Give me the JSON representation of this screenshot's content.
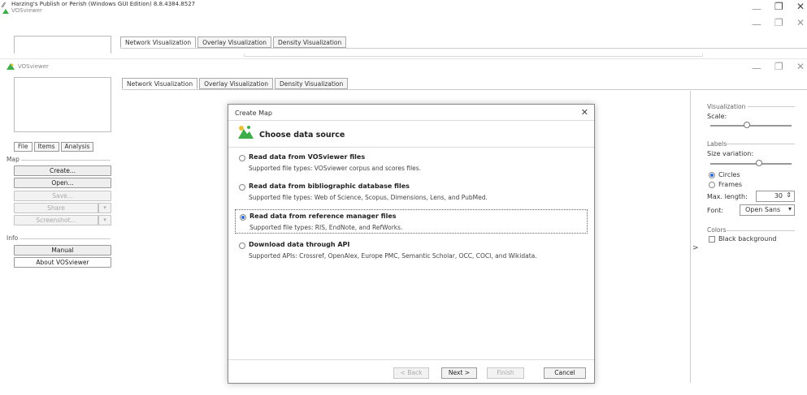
{
  "outer_window": {
    "title": "Harzing's Publish or Perish (Windows GUI Edition) 8.8.4384.8527",
    "subtitle": "VOSviewer",
    "controls": {
      "minimize": "—",
      "maximize": "❐",
      "close": "✕"
    }
  },
  "back_window": {
    "tabs": [
      "Network Visualization",
      "Overlay Visualization",
      "Density Visualization"
    ]
  },
  "main_window": {
    "title": "VOSviewer",
    "controls": {
      "minimize": "—",
      "maximize": "❐",
      "close": "✕"
    },
    "tabs": [
      {
        "label": "Network Visualization",
        "active": true
      },
      {
        "label": "Overlay Visualization",
        "active": false
      },
      {
        "label": "Density Visualization",
        "active": false
      }
    ]
  },
  "left_panel": {
    "tabs": [
      {
        "label": "File",
        "active": true
      },
      {
        "label": "Items",
        "active": false
      },
      {
        "label": "Analysis",
        "active": false
      }
    ],
    "map_section": "Map",
    "map_buttons": {
      "create": "Create...",
      "open": "Open...",
      "save": "Save...",
      "share": "Share",
      "screenshot": "Screenshot..."
    },
    "info_section": "Info",
    "info_buttons": {
      "manual": "Manual",
      "about": "About VOSviewer"
    }
  },
  "right_panel": {
    "visualization_label": "Visualization",
    "scale_label": "Scale:",
    "scale_level": 0.45,
    "labels_label": "Labels",
    "size_variation_label": "Size variation:",
    "size_variation_level": 0.6,
    "circles_label": "Circles",
    "frames_label": "Frames",
    "label_shape_selected": "Circles",
    "max_length_label": "Max. length:",
    "max_length_value": "30",
    "font_label": "Font:",
    "font_value": "Open Sans",
    "colors_label": "Colors",
    "black_background_label": "Black background",
    "black_background_checked": false,
    "expand_arrow": ">"
  },
  "dialog": {
    "title": "Create Map",
    "close": "✕",
    "header": "Choose data source",
    "options": [
      {
        "label": "Read data from VOSviewer files",
        "desc": "Supported file types: VOSviewer corpus and scores files.",
        "selected": false
      },
      {
        "label": "Read data from bibliographic database files",
        "desc": "Supported file types: Web of Science, Scopus, Dimensions, Lens, and PubMed.",
        "selected": false
      },
      {
        "label": "Read data from reference manager files",
        "desc": "Supported file types: RIS, EndNote, and RefWorks.",
        "selected": true
      },
      {
        "label": "Download data through API",
        "desc": "Supported APIs: Crossref, OpenAlex, Europe PMC, Semantic Scholar, OCC, COCI, and Wikidata.",
        "selected": false
      }
    ],
    "buttons": {
      "back": "< Back",
      "next": "Next >",
      "finish": "Finish",
      "cancel": "Cancel"
    }
  },
  "colors": {
    "logo_green": "#3fae4a",
    "logo_yellow": "#e8c23a",
    "radio_blue": "#2a6ad6"
  }
}
